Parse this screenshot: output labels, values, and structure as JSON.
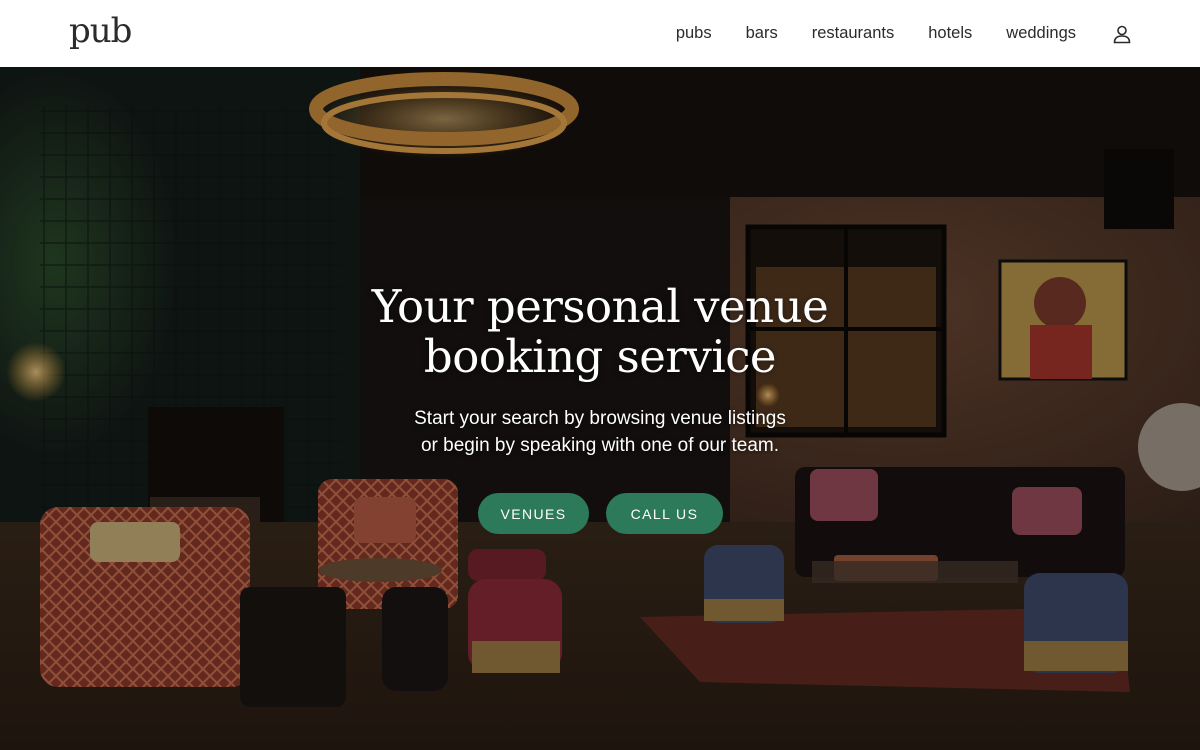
{
  "header": {
    "logo": "pub",
    "nav": [
      {
        "label": "pubs"
      },
      {
        "label": "bars"
      },
      {
        "label": "restaurants"
      },
      {
        "label": "hotels"
      },
      {
        "label": "weddings"
      }
    ],
    "account_icon": "user-icon"
  },
  "hero": {
    "title_line1": "Your personal venue",
    "title_line2": "booking service",
    "subtitle_line1": "Start your search by browsing venue listings",
    "subtitle_line2": "or begin by speaking with one of our team.",
    "buttons": {
      "venues": "VENUES",
      "call": "CALL US"
    },
    "button_color": "#2c7a5a"
  }
}
